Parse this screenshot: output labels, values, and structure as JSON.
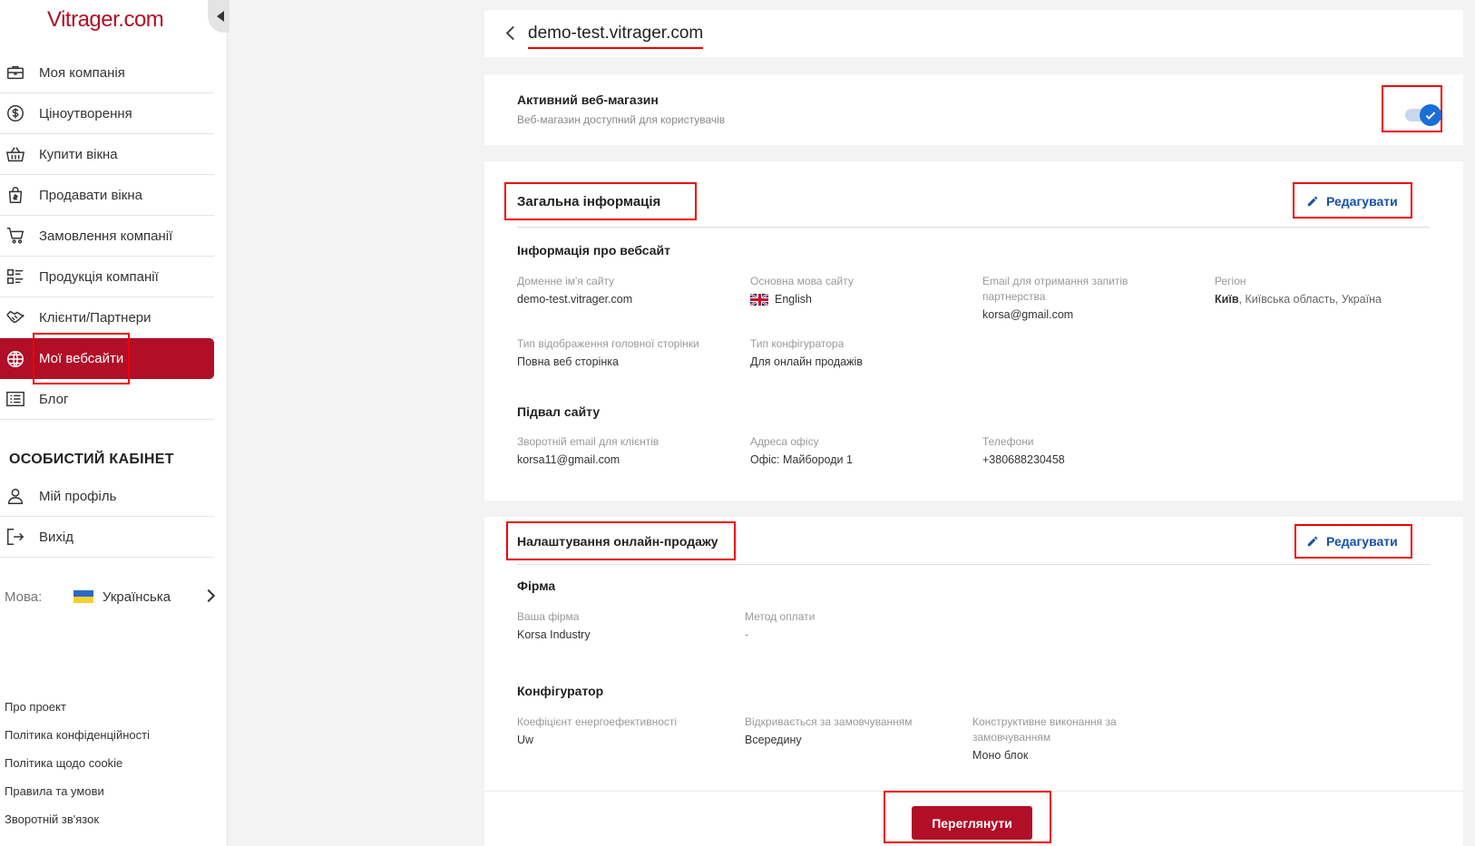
{
  "app": {
    "logo": "Vitrager.com"
  },
  "sidebar": {
    "items": [
      {
        "label": "Моя компанія",
        "icon": "briefcase-icon"
      },
      {
        "label": "Ціноутворення",
        "icon": "dollar-icon"
      },
      {
        "label": "Купити вікна",
        "icon": "basket-icon"
      },
      {
        "label": "Продавати вікна",
        "icon": "bag-icon"
      },
      {
        "label": "Замовлення компанії",
        "icon": "cart-icon"
      },
      {
        "label": "Продукція компанії",
        "icon": "list-grid-icon"
      },
      {
        "label": "Клієнти/Партнери",
        "icon": "handshake-icon"
      },
      {
        "label": "Мої вебсайти",
        "icon": "globe-icon",
        "active": true
      },
      {
        "label": "Блог",
        "icon": "blog-icon"
      }
    ],
    "cabinet_title": "ОСОБИСТИЙ КАБІНЕТ",
    "cabinet_items": [
      {
        "label": "Мій профіль",
        "icon": "user-icon"
      },
      {
        "label": "Вихід",
        "icon": "logout-icon"
      }
    ],
    "language": {
      "label": "Мова:",
      "value": "Українська"
    },
    "footer_links": [
      "Про проект",
      "Політика конфіденційності",
      "Політика щодо cookie",
      "Правила та умови",
      "Зворотній зв'язок"
    ]
  },
  "header": {
    "title": "demo-test.vitrager.com"
  },
  "active_shop": {
    "title": "Активний веб-магазин",
    "subtitle": "Веб-магазин доступний для користувачів",
    "enabled": true
  },
  "general": {
    "title": "Загальна інформація",
    "edit_label": "Редагувати",
    "website_info": {
      "title": "Інформація про вебсайт",
      "fields": [
        {
          "key": "Доменне ім'я сайту",
          "value": "demo-test.vitrager.com"
        },
        {
          "key": "Основна мова сайту",
          "value": "English"
        },
        {
          "key": "Email для отримання запитів партнерства",
          "value": "korsa@gmail.com"
        },
        {
          "key": "Регіон",
          "value_bold": "Київ",
          "value": ", Київська область, Україна"
        },
        {
          "key": "Тип відображення головної сторінки",
          "value": "Повна веб сторінка"
        },
        {
          "key": "Тип конфігуратора",
          "value": "Для онлайн продажів"
        }
      ]
    },
    "footer_info": {
      "title": "Підвал сайту",
      "fields": [
        {
          "key": "Зворотній email для клієнтів",
          "value": "korsa11@gmail.com"
        },
        {
          "key": "Адреса офісу",
          "value": "Офіс: Майбороди 1"
        },
        {
          "key": "Телефони",
          "value": "+380688230458"
        }
      ]
    }
  },
  "sales": {
    "title": "Налаштування онлайн-продажу",
    "edit_label": "Редагувати",
    "firm": {
      "title": "Фірма",
      "fields": [
        {
          "key": "Ваша фірма",
          "value": "Korsa Industry"
        },
        {
          "key": "Метод оплати",
          "value": "-"
        }
      ]
    },
    "configurator": {
      "title": "Конфігуратор",
      "fields": [
        {
          "key": "Коефіцієнт енергоефективності",
          "value": "Uw"
        },
        {
          "key": "Відкривається за замовчуванням",
          "value": "Всередину"
        },
        {
          "key": "Конструктивне виконання за замовчуванням",
          "value": "Моно блок"
        }
      ]
    },
    "view_label": "Переглянути"
  }
}
